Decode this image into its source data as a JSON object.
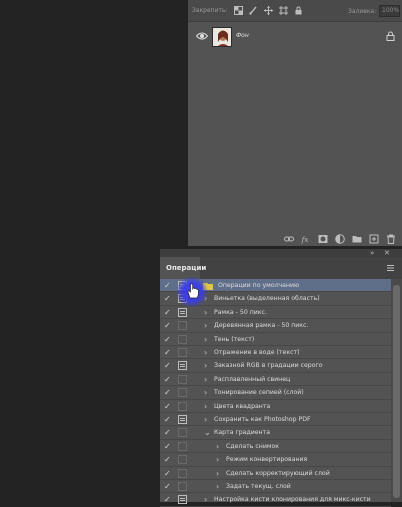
{
  "layers": {
    "opacity_label": "Закрепить:",
    "fill_label": "Заливка:",
    "fill_value": "100%",
    "layer_name": "Фон",
    "icons": [
      "eye-icon",
      "lock-icon",
      "link-icon",
      "fx-icon",
      "mask-icon",
      "adjustment-icon",
      "folder-icon",
      "new-layer-icon",
      "trash-icon"
    ]
  },
  "actions": {
    "tab_label": "Операции",
    "panel_controls": {
      "collapse": "»",
      "close": "✕"
    },
    "accent": "#5f6f8a",
    "rows": [
      {
        "label": "Операции по умолчанию",
        "checked": true,
        "dialog": true,
        "indent": 0,
        "expanded": true,
        "is_set": true
      },
      {
        "label": "Виньетка (выделенная область)",
        "checked": true,
        "dialog": true,
        "indent": 1,
        "expanded": false
      },
      {
        "label": "Рамка - 50 пикс.",
        "checked": true,
        "dialog": true,
        "indent": 1,
        "expanded": false
      },
      {
        "label": "Деревянная рамка - 50 пикс.",
        "checked": true,
        "dialog": false,
        "indent": 1,
        "expanded": false
      },
      {
        "label": "Тень (текст)",
        "checked": true,
        "dialog": false,
        "indent": 1,
        "expanded": false
      },
      {
        "label": "Отражение в воде (текст)",
        "checked": true,
        "dialog": false,
        "indent": 1,
        "expanded": false
      },
      {
        "label": "Заказной RGB в градации серого",
        "checked": true,
        "dialog": true,
        "indent": 1,
        "expanded": false
      },
      {
        "label": "Расплавленный свинец",
        "checked": true,
        "dialog": false,
        "indent": 1,
        "expanded": false
      },
      {
        "label": "Тонирование сепией (слой)",
        "checked": true,
        "dialog": false,
        "indent": 1,
        "expanded": false
      },
      {
        "label": "Цвета квадранта",
        "checked": true,
        "dialog": false,
        "indent": 1,
        "expanded": false
      },
      {
        "label": "Сохранить как Photoshop PDF",
        "checked": true,
        "dialog": true,
        "indent": 1,
        "expanded": false
      },
      {
        "label": "Карта градиента",
        "checked": true,
        "dialog": false,
        "indent": 1,
        "expanded": true
      },
      {
        "label": "Сделать снимок",
        "checked": true,
        "dialog": false,
        "indent": 2,
        "expanded": false
      },
      {
        "label": "Режим конвертирования",
        "checked": true,
        "dialog": false,
        "indent": 2,
        "expanded": false
      },
      {
        "label": "Сделать корректирующий слой",
        "checked": true,
        "dialog": false,
        "indent": 2,
        "expanded": false
      },
      {
        "label": "Задать текущ. слой",
        "checked": true,
        "dialog": false,
        "indent": 2,
        "expanded": false
      },
      {
        "label": "Настройка кисти клонирования для микс-кисти",
        "checked": true,
        "dialog": true,
        "indent": 1,
        "expanded": false
      }
    ]
  }
}
